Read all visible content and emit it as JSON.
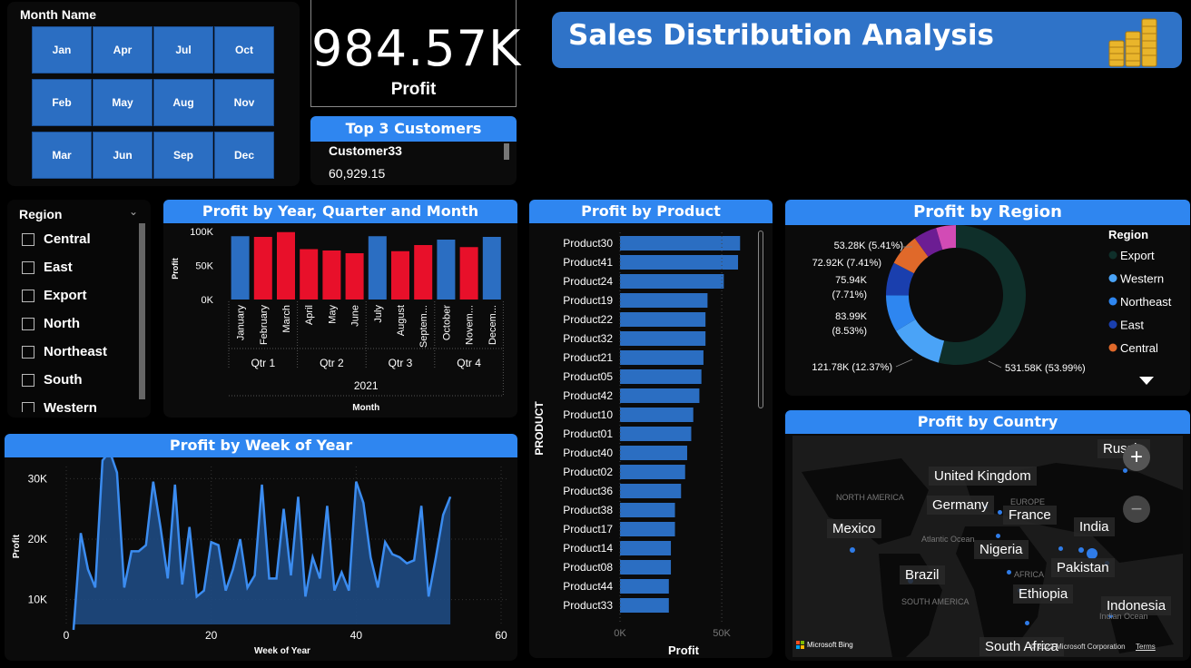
{
  "months": {
    "title": "Month Name",
    "items": [
      "Jan",
      "Apr",
      "Jul",
      "Oct",
      "Feb",
      "May",
      "Aug",
      "Nov",
      "Mar",
      "Jun",
      "Sep",
      "Dec"
    ]
  },
  "kpi": {
    "value": "984.57K",
    "label": "Profit"
  },
  "top_customers": {
    "title": "Top 3 Customers",
    "name": "Customer33",
    "value": "60,929.15"
  },
  "banner": {
    "title": "Sales Distribution Analysis",
    "icon": "coins-icon"
  },
  "region_slicer": {
    "title": "Region",
    "items": [
      "Central",
      "East",
      "Export",
      "North",
      "Northeast",
      "South",
      "Western"
    ]
  },
  "colors": {
    "accent": "#2f86f0",
    "bar_blue": "#2b6ec2",
    "bar_red": "#e8102a",
    "line": "#3b8cf0"
  },
  "chart_data": [
    {
      "type": "bar",
      "title": "Profit by Year, Quarter and Month",
      "categories": [
        "January",
        "February",
        "March",
        "April",
        "May",
        "June",
        "July",
        "August",
        "Septem...",
        "October",
        "Novem...",
        "Decem..."
      ],
      "values": [
        93000,
        92000,
        99000,
        74000,
        72000,
        68000,
        93000,
        71000,
        80000,
        88000,
        77000,
        92000
      ],
      "highlight": [
        false,
        true,
        true,
        true,
        true,
        true,
        false,
        true,
        true,
        false,
        true,
        false
      ],
      "quarters": [
        "Qtr 1",
        "Qtr 2",
        "Qtr 3",
        "Qtr 4"
      ],
      "year": "2021",
      "xlabel": "Month",
      "ylabel": "Profit",
      "yticks": [
        "0K",
        "50K",
        "100K"
      ],
      "ylim": [
        0,
        100000
      ]
    },
    {
      "type": "bar",
      "orientation": "horizontal",
      "title": "Profit by Product",
      "categories": [
        "Product30",
        "Product41",
        "Product24",
        "Product19",
        "Product22",
        "Product32",
        "Product21",
        "Product05",
        "Product42",
        "Product10",
        "Product01",
        "Product40",
        "Product02",
        "Product36",
        "Product38",
        "Product17",
        "Product14",
        "Product08",
        "Product44",
        "Product33"
      ],
      "values": [
        59000,
        58000,
        51000,
        43000,
        42000,
        42000,
        41000,
        40000,
        39000,
        36000,
        35000,
        33000,
        32000,
        30000,
        27000,
        27000,
        25000,
        25000,
        24000,
        24000
      ],
      "xlabel": "Profit",
      "ylabel": "PRODUCT",
      "xticks": [
        "0K",
        "50K"
      ],
      "xlim": [
        0,
        62000
      ]
    },
    {
      "type": "pie",
      "title": "Profit by Region",
      "legend_title": "Region",
      "legend": [
        "Export",
        "Western",
        "Northeast",
        "East",
        "Central"
      ],
      "slices": [
        {
          "label": "531.58K (53.99%)",
          "value": 531.58,
          "color": "#0f2f2a"
        },
        {
          "label": "121.78K (12.37%)",
          "value": 121.78,
          "color": "#4aa3f7"
        },
        {
          "label": "83.99K (8.53%)",
          "value": 83.99,
          "color": "#2e86f0"
        },
        {
          "label": "75.94K (7.71%)",
          "value": 75.94,
          "color": "#1a3fae"
        },
        {
          "label": "72.92K (7.41%)",
          "value": 72.92,
          "color": "#e0692a"
        },
        {
          "label": "53.28K (5.41%)",
          "value": 53.28,
          "color": "#6c1d93"
        },
        {
          "label": "",
          "value": 45.0,
          "color": "#d24bb5"
        }
      ]
    },
    {
      "type": "area",
      "title": "Profit by Week of Year",
      "xlabel": "Week of Year",
      "ylabel": "Profit",
      "xticks": [
        "0",
        "20",
        "40",
        "60"
      ],
      "yticks": [
        "10K",
        "20K",
        "30K"
      ],
      "xlim": [
        0,
        60
      ],
      "ylim": [
        2000,
        35000
      ],
      "x": [
        1,
        2,
        3,
        4,
        5,
        6,
        7,
        8,
        9,
        10,
        11,
        12,
        13,
        14,
        15,
        16,
        17,
        18,
        19,
        20,
        21,
        22,
        23,
        24,
        25,
        26,
        27,
        28,
        29,
        30,
        31,
        32,
        33,
        34,
        35,
        36,
        37,
        38,
        39,
        40,
        41,
        42,
        43,
        44,
        45,
        46,
        47,
        48,
        49,
        50,
        51,
        52,
        53
      ],
      "values": [
        5000,
        21000,
        15000,
        12000,
        33000,
        34500,
        31000,
        12000,
        18000,
        18000,
        19000,
        29500,
        22000,
        13500,
        29000,
        12500,
        22000,
        10500,
        11500,
        19500,
        19000,
        11500,
        15000,
        20000,
        12000,
        14000,
        29000,
        13500,
        13500,
        25000,
        14000,
        27000,
        10500,
        17000,
        13500,
        25500,
        11500,
        14500,
        11500,
        29500,
        26000,
        17000,
        12000,
        19500,
        17500,
        17000,
        16000,
        16500,
        25500,
        10500,
        17000,
        24000,
        27000
      ]
    }
  ],
  "country_map": {
    "title": "Profit by Country",
    "labels": [
      "Russia",
      "United Kingdom",
      "Germany",
      "France",
      "Mexico",
      "India",
      "Nigeria",
      "Pakistan",
      "Brazil",
      "Ethiopia",
      "Indonesia",
      "South Africa"
    ],
    "region_labels": [
      "NORTH AMERICA",
      "EUROPE",
      "Atlantic Ocean",
      "AFRICA",
      "SOUTH AMERICA",
      "Indian Ocean"
    ],
    "attribution": "Microsoft Bing",
    "copyright": "© 2022 Microsoft Corporation",
    "terms": "Terms",
    "zoom_in": "+",
    "zoom_out": "−"
  }
}
